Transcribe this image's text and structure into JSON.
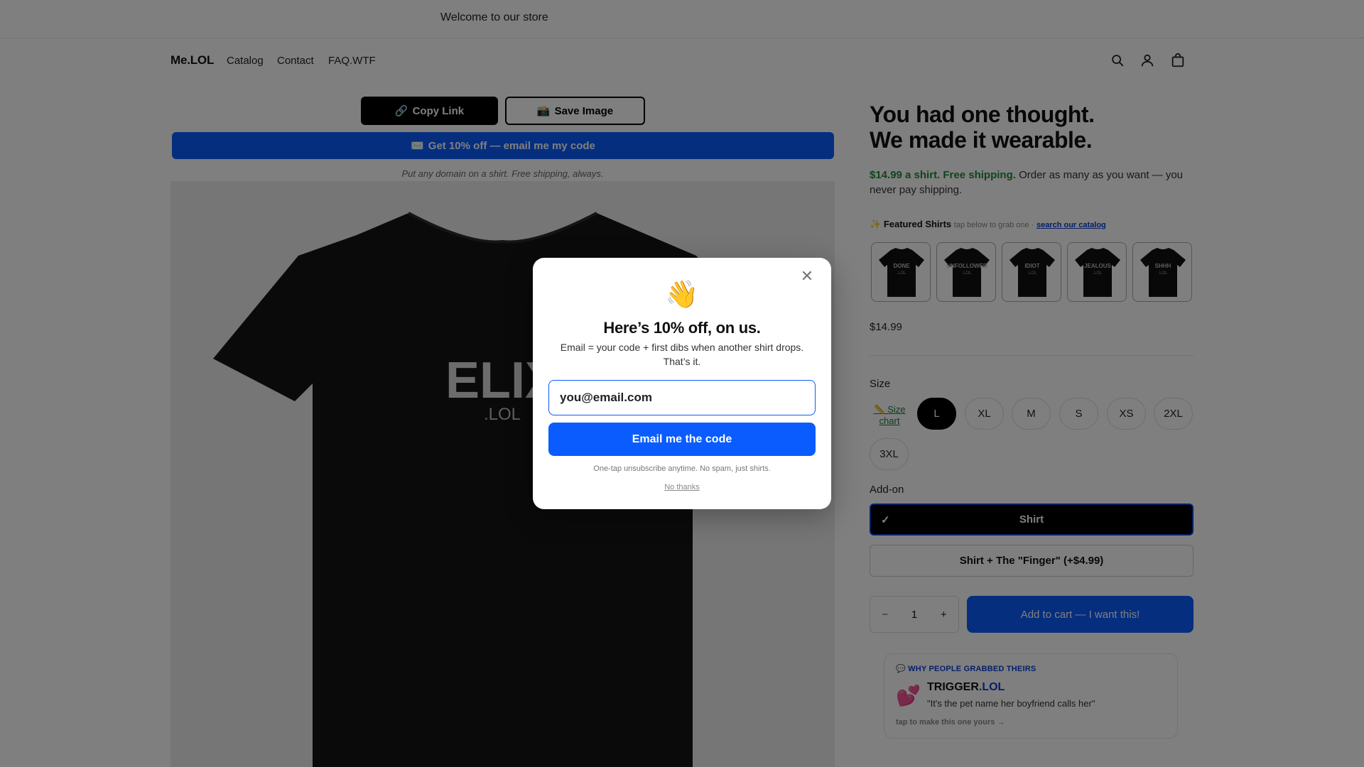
{
  "announcement": "Welcome to our store",
  "header": {
    "logo": "Me.LOL",
    "nav": [
      "Catalog",
      "Contact",
      "FAQ.WTF"
    ],
    "icons": [
      "search-icon",
      "account-icon",
      "cart-icon"
    ]
  },
  "actions": {
    "copy_link": "Copy Link",
    "copy_link_icon": "🔗",
    "save_image": "Save Image",
    "save_image_icon": "📸",
    "promo": "Get 10% off — email me my code",
    "promo_icon": "✉️",
    "tagline": "Put any domain on a shirt. Free shipping, always."
  },
  "product_image": {
    "shirt_text": "ELIX",
    "shirt_subtext": ".LOL"
  },
  "product": {
    "title_line1": "You had one thought.",
    "title_line2": "We made it wearable.",
    "shipping_highlight": "$14.99 a shirt. Free shipping.",
    "shipping_rest": " Order as many as you want — you never pay shipping.",
    "featured": {
      "icon": "✨",
      "label": "Featured Shirts",
      "hint": "tap below to grab one ·",
      "link": "search our catalog",
      "shirts": [
        {
          "name": "DONE",
          "suffix": ".LOL"
        },
        {
          "name": "UNFOLLOWED",
          "suffix": ".LOL"
        },
        {
          "name": "IDIOT",
          "suffix": ".LOL"
        },
        {
          "name": "JEALOUS",
          "suffix": ".LOL"
        },
        {
          "name": "SHHH",
          "suffix": ".LOL"
        }
      ]
    },
    "price": "$14.99",
    "size_label": "Size",
    "size_chart": "📏 Size chart",
    "sizes": [
      "L",
      "XL",
      "M",
      "S",
      "XS",
      "2XL",
      "3XL"
    ],
    "selected_size": "L",
    "addon_label": "Add-on",
    "addons": [
      "Shirt",
      "Shirt + The \"Finger\" (+$4.99)"
    ],
    "selected_addon_check": "✓",
    "quantity": "1",
    "qty_minus": "−",
    "qty_plus": "+",
    "add_to_cart": "Add to cart — I want this!"
  },
  "review": {
    "header_icon": "💬",
    "header": "WHY PEOPLE GRABBED THEIRS",
    "heart": "💕",
    "brand": "TRIGGER",
    "brand_suffix": ".LOL",
    "quote": "\"It's the pet name her boyfriend calls her\"",
    "tap": "tap to make this one yours →"
  },
  "modal": {
    "wave": "👋",
    "title": "Here’s 10% off, on us.",
    "subtitle": "Email = your code + first dibs when another shirt drops. That’s it.",
    "email_value": "you@email.com",
    "submit": "Email me the code",
    "fine_print": "One-tap unsubscribe anytime. No spam, just shirts.",
    "no_thanks": "No thanks",
    "close": "✕"
  },
  "colors": {
    "accent_blue": "#0a5cff",
    "price_green": "#1c8a3a",
    "overlay": "rgba(0,0,0,0.5)"
  }
}
